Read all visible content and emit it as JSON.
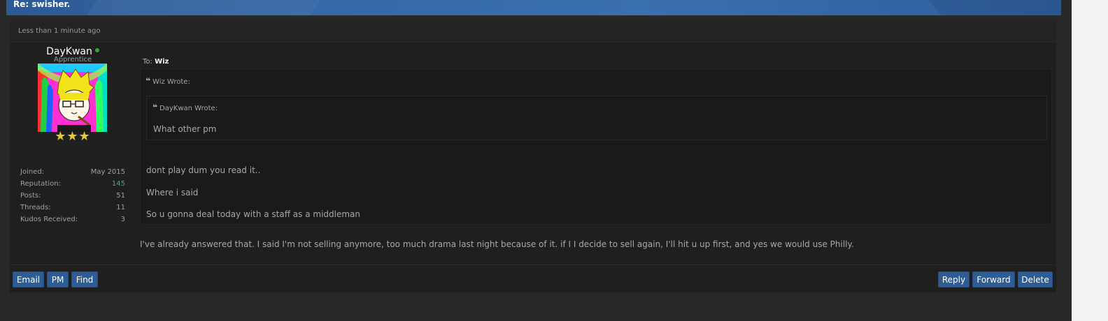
{
  "title": "Re: swisher.",
  "post": {
    "time": "Less than 1 minute ago",
    "author": {
      "username": "DayKwan",
      "online": true,
      "usertitle": "Apprentice",
      "stars": "★★★",
      "stats": [
        {
          "label": "Joined:",
          "value": "May 2015"
        },
        {
          "label": "Reputation:",
          "value": "145"
        },
        {
          "label": "Posts:",
          "value": "51"
        },
        {
          "label": "Threads:",
          "value": "11"
        },
        {
          "label": "Kudos Received:",
          "value": "3"
        }
      ]
    },
    "to_label": "To:",
    "to_name": "Wiz",
    "outer_quote": {
      "author_line": "Wiz Wrote:",
      "inner_quote": {
        "author_line": "DayKwan Wrote:",
        "text": "What other pm"
      },
      "lines": [
        "dont play dum you read it..",
        "Where i said",
        "So u gonna deal today with a staff as a middleman"
      ]
    },
    "body": "I've already answered that. I said I'm not selling anymore, too much drama last night because of it. if I I decide to sell again, I'll hit u up first, and yes we would use Philly."
  },
  "buttons": {
    "left": [
      "Email",
      "PM",
      "Find"
    ],
    "right": [
      "Reply",
      "Forward",
      "Delete"
    ]
  },
  "colors": {
    "accent": "#2e5d96",
    "online": "#2fa82f",
    "reputation": "#3cb371"
  }
}
